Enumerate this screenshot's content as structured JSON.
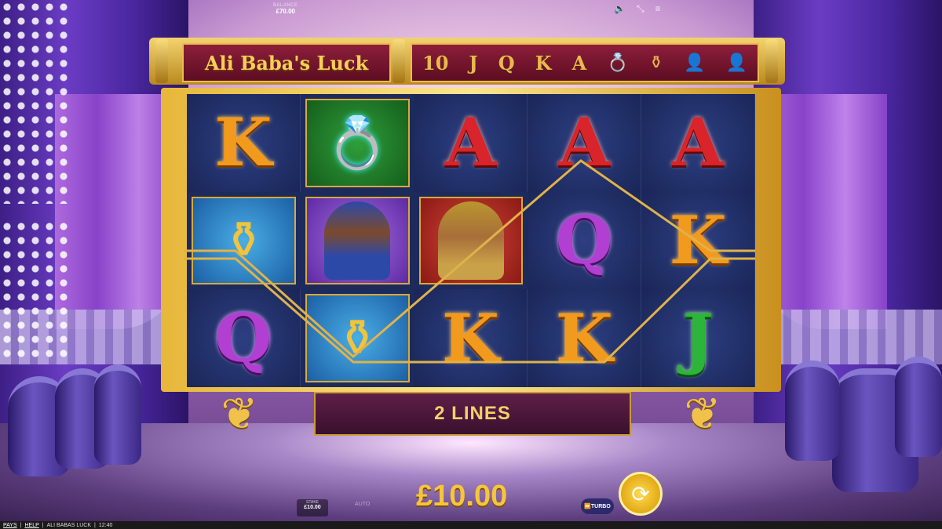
{
  "status_bar": {
    "balance_label": "BALANCE",
    "balance_value": "£70.00",
    "icons": [
      "speaker-icon",
      "fullscreen-icon",
      "menu-icon"
    ]
  },
  "header": {
    "title": "Ali Baba's Luck",
    "paytable_symbols": [
      "10",
      "J",
      "Q",
      "K",
      "A",
      "ring",
      "vase",
      "woman",
      "man"
    ]
  },
  "reels": {
    "rows": [
      [
        {
          "symbol": "K",
          "type": "letter"
        },
        {
          "symbol": "ring",
          "type": "tile",
          "bg": "green"
        },
        {
          "symbol": "A",
          "type": "letter"
        },
        {
          "symbol": "A",
          "type": "letter"
        },
        {
          "symbol": "A",
          "type": "letter"
        }
      ],
      [
        {
          "symbol": "vase",
          "type": "tile",
          "bg": "blue"
        },
        {
          "symbol": "woman",
          "type": "tile",
          "bg": "purple"
        },
        {
          "symbol": "man",
          "type": "tile",
          "bg": "red"
        },
        {
          "symbol": "Q",
          "type": "letter"
        },
        {
          "symbol": "K",
          "type": "letter"
        }
      ],
      [
        {
          "symbol": "Q",
          "type": "letter"
        },
        {
          "symbol": "vase",
          "type": "tile",
          "bg": "blue"
        },
        {
          "symbol": "K",
          "type": "letter"
        },
        {
          "symbol": "K",
          "type": "letter"
        },
        {
          "symbol": "J",
          "type": "letter"
        }
      ]
    ]
  },
  "lines_banner": {
    "count": "2",
    "label": "LINES",
    "text": "2 LINES"
  },
  "controls": {
    "stake_label": "STAKE",
    "stake_value": "£10.00",
    "auto_label": "AUTO",
    "bet_display": "£10.00",
    "turbo_label": "TURBO",
    "spin_icon": "spin-icon"
  },
  "footer": {
    "pays_label": "PAYS",
    "help_label": "HELP",
    "game_name": "ALI BABAS LUCK",
    "clock": "12:40"
  },
  "colors": {
    "gold": "#f7c53a",
    "banner": "#5f1f48",
    "reel_bg": "#1d2a5c"
  }
}
